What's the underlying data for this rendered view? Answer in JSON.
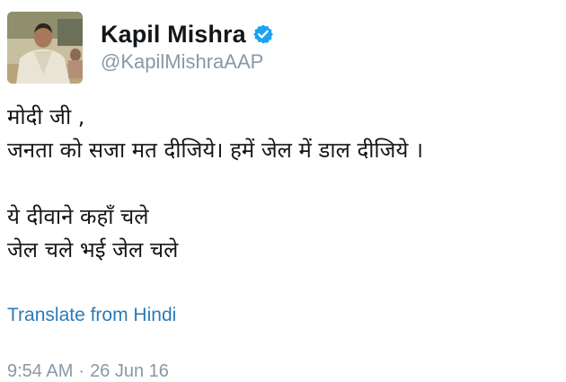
{
  "author": {
    "display_name": "Kapil Mishra",
    "handle": "@KapilMishraAAP",
    "verified": true,
    "avatar_icon": "profile-photo"
  },
  "tweet": {
    "lines": [
      "मोदी जी ,",
      "जनता को सजा मत दीजिये। हमें जेल में डाल दीजिये ।",
      "",
      "ये दीवाने कहाँ चले",
      "जेल चले भई जेल चले"
    ],
    "translate_label": "Translate from Hindi"
  },
  "meta": {
    "time": "9:54 AM",
    "separator": "·",
    "date": "26 Jun 16"
  },
  "colors": {
    "text": "#14171a",
    "muted": "#8899a6",
    "link": "#2b7bb9",
    "verified": "#1da1f2"
  }
}
